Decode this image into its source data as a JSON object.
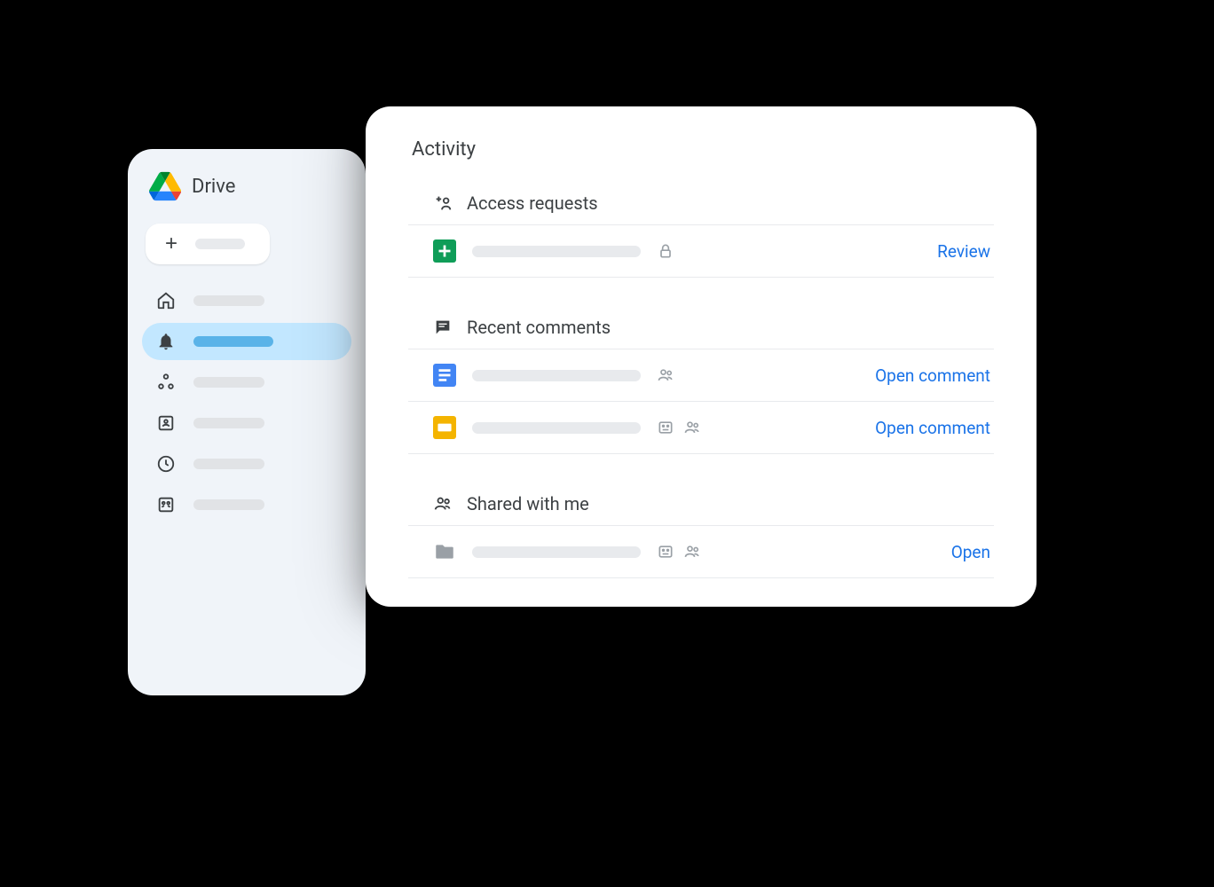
{
  "sidebar": {
    "title": "Drive",
    "nav": {
      "home": "",
      "activity": "",
      "shared": "",
      "storage": "",
      "recent": "",
      "contacts": ""
    }
  },
  "activity": {
    "title": "Activity",
    "sections": {
      "access": {
        "label": "Access requests",
        "items": [
          {
            "action": "Review",
            "type": "sheets"
          }
        ]
      },
      "comments": {
        "label": "Recent comments",
        "items": [
          {
            "action": "Open comment",
            "type": "docs"
          },
          {
            "action": "Open comment",
            "type": "slides"
          }
        ]
      },
      "shared": {
        "label": "Shared with me",
        "items": [
          {
            "action": "Open",
            "type": "folder"
          }
        ]
      }
    }
  }
}
